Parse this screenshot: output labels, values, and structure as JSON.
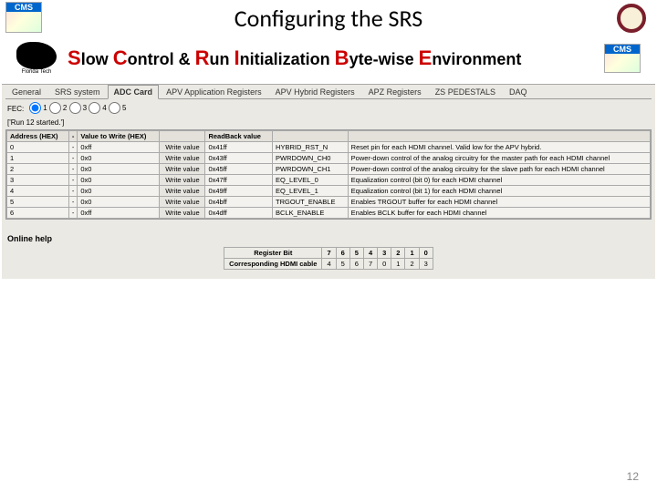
{
  "page": {
    "title": "Configuring the SRS",
    "number": "12"
  },
  "scribe": {
    "w1": {
      "cap": "S",
      "rest": "low"
    },
    "w2": {
      "cap": "C",
      "rest": "ontrol"
    },
    "amp": "&",
    "w3": {
      "cap": "R",
      "rest": "un"
    },
    "w4": {
      "cap": "I",
      "rest": "nitialization"
    },
    "w5": {
      "cap": "B",
      "rest": "yte-wise"
    },
    "w6": {
      "cap": "E",
      "rest": "nvironment"
    }
  },
  "panther_label": "Florida Tech",
  "tabs": [
    "General",
    "SRS system",
    "ADC Card",
    "APV Application Registers",
    "APV Hybrid Registers",
    "APZ Registers",
    "ZS PEDESTALS",
    "DAQ"
  ],
  "activeTab": 2,
  "fec": {
    "label": "FEC:",
    "options": [
      "1",
      "2",
      "3",
      "4",
      "5"
    ],
    "selected": 0
  },
  "status": "['Run 12 started.']",
  "columns": [
    "Address (HEX)",
    "-",
    "Value to Write (HEX)",
    "",
    "ReadBack value",
    "",
    ""
  ],
  "writeBtn": "Write value",
  "rows": [
    {
      "addr": "0",
      "sep": "-",
      "val": "0xff",
      "rb": "0x41ff",
      "reg": "HYBRID_RST_N",
      "desc": "Reset pin for each HDMI channel. Valid low for the APV hybrid."
    },
    {
      "addr": "1",
      "sep": "-",
      "val": "0x0",
      "rb": "0x43ff",
      "reg": "PWRDOWN_CH0",
      "desc": "Power-down control of the analog circuitry for the master path for each HDMI channel"
    },
    {
      "addr": "2",
      "sep": "-",
      "val": "0x0",
      "rb": "0x45ff",
      "reg": "PWRDOWN_CH1",
      "desc": "Power-down control of the analog circuitry for the slave path for each HDMI channel"
    },
    {
      "addr": "3",
      "sep": "-",
      "val": "0x0",
      "rb": "0x47ff",
      "reg": "EQ_LEVEL_0",
      "desc": "Equalization control (bit 0) for each HDMI channel"
    },
    {
      "addr": "4",
      "sep": "-",
      "val": "0x0",
      "rb": "0x49ff",
      "reg": "EQ_LEVEL_1",
      "desc": "Equalization control (bit 1) for each HDMI channel"
    },
    {
      "addr": "5",
      "sep": "-",
      "val": "0x0",
      "rb": "0x4bff",
      "reg": "TRGOUT_ENABLE",
      "desc": "Enables TRGOUT buffer for each HDMI channel"
    },
    {
      "addr": "6",
      "sep": "-",
      "val": "0xff",
      "rb": "0x4dff",
      "reg": "BCLK_ENABLE",
      "desc": "Enables BCLK buffer for each HDMI channel"
    }
  ],
  "help": {
    "label": "Online help",
    "rowA_head": "Register Bit",
    "rowB_head": "Corresponding HDMI cable",
    "bits": [
      "7",
      "6",
      "5",
      "4",
      "3",
      "2",
      "1",
      "0"
    ],
    "cables": [
      "4",
      "5",
      "6",
      "7",
      "0",
      "1",
      "2",
      "3"
    ]
  }
}
